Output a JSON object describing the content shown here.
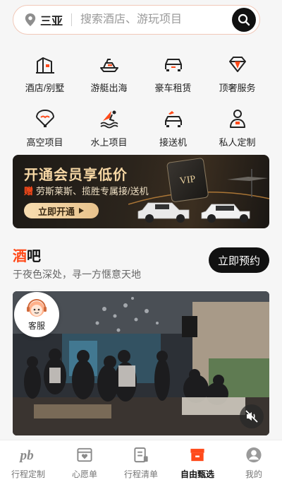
{
  "search": {
    "city": "三亚",
    "placeholder": "搜索酒店、游玩项目"
  },
  "categories": [
    {
      "label": "酒店/别墅",
      "icon": "hotel-icon"
    },
    {
      "label": "游艇出海",
      "icon": "yacht-icon"
    },
    {
      "label": "豪车租赁",
      "icon": "car-icon"
    },
    {
      "label": "顶奢服务",
      "icon": "diamond-icon"
    },
    {
      "label": "高空项目",
      "icon": "parachute-icon"
    },
    {
      "label": "水上项目",
      "icon": "surfing-icon"
    },
    {
      "label": "接送机",
      "icon": "airport-transfer-icon"
    },
    {
      "label": "私人定制",
      "icon": "custom-person-icon"
    }
  ],
  "vip_banner": {
    "title": "开通会员享低价",
    "gift_mark": "赠",
    "subtitle": "劳斯莱斯、揽胜专属接/送机",
    "button": "立即开通",
    "card_text": "VIP"
  },
  "section": {
    "title_accent": "酒",
    "title_rest": "吧",
    "subtitle": "于夜色深处，寻一方惬意天地",
    "book_button": "立即预约"
  },
  "service": {
    "label": "客服"
  },
  "tabs": [
    {
      "label": "行程定制",
      "icon": "pb-logo-icon",
      "active": false
    },
    {
      "label": "心愿单",
      "icon": "wishlist-icon",
      "active": false
    },
    {
      "label": "行程清单",
      "icon": "list-icon",
      "active": false
    },
    {
      "label": "自由甄选",
      "icon": "store-icon",
      "active": true
    },
    {
      "label": "我的",
      "icon": "profile-icon",
      "active": false
    }
  ],
  "colors": {
    "accent": "#ff4a1a",
    "dark": "#111111",
    "gold": "#f6d7a4"
  }
}
